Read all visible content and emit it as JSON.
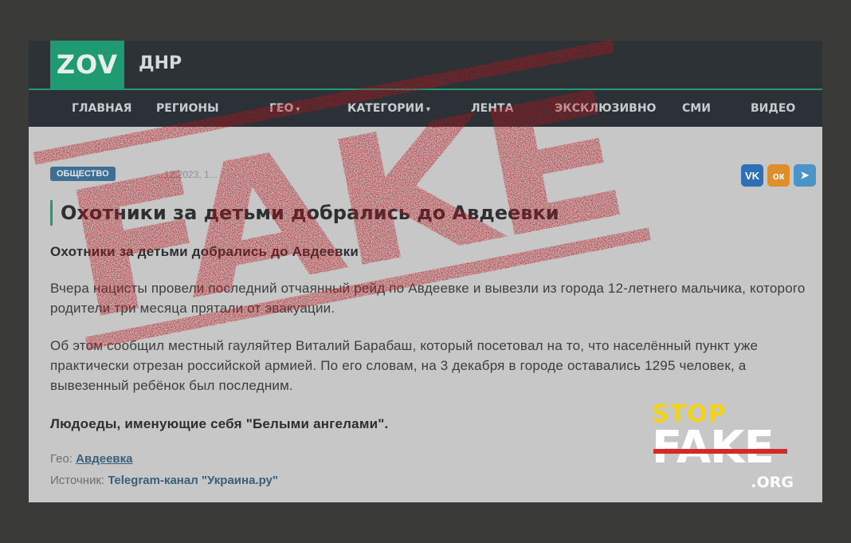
{
  "site": {
    "logo": "ZOV",
    "region": "ДНР"
  },
  "nav": [
    {
      "label": "ГЛАВНАЯ",
      "chevron": false
    },
    {
      "label": "РЕГИОНЫ",
      "chevron": false
    },
    {
      "label": "ГЕО",
      "chevron": true
    },
    {
      "label": "КАТЕГОРИИ",
      "chevron": true
    },
    {
      "label": "ЛЕНТА",
      "chevron": false
    },
    {
      "label": "ЭКСКЛЮЗИВНО",
      "chevron": false
    },
    {
      "label": "СМИ",
      "chevron": false
    },
    {
      "label": "ВИДЕО",
      "chevron": false
    }
  ],
  "article": {
    "tag": "ОБЩЕСТВО",
    "date": "...12.2023, 1...",
    "share": [
      {
        "name": "vk",
        "label": "VK",
        "color": "#2f6fb4"
      },
      {
        "name": "ok",
        "label": "ок",
        "color": "#e08e2a"
      },
      {
        "name": "telegram",
        "label": "➤",
        "color": "#4a94c7"
      }
    ],
    "title": "Охотники за детьми добрались до Авдеевки",
    "lead": "Охотники за детьми добрались до Авдеевки",
    "p1": "Вчера нацисты провели последний отчаянный рейд по Авдеевке и вывезли из города 12-летнего мальчика, которого родители три месяца прятали от эвакуации.",
    "p2": "Об этом сообщил местный гауляйтер Виталий Барабаш, который посетовал на то, что населённый пункт уже практически отрезан российской армией. По его словам, на 3 декабря в городе оставались 1295 человек, а вывезенный ребёнок был последним.",
    "bold_line": "Людоеды, именующие себя \"Белыми ангелами\".",
    "geo_label": "Гео:",
    "geo_value": "Авдеевка",
    "source_label": "Источник:",
    "source_value": "Telegram-канал \"Украина.ру\""
  },
  "stamp": {
    "text": "FAKE",
    "color": "#b9141b"
  },
  "stopfake": {
    "stop": "STOP",
    "fake": "FAKE",
    "org": ".ORG",
    "stop_color": "#f2d21d",
    "strike_color": "#d12a2a"
  }
}
